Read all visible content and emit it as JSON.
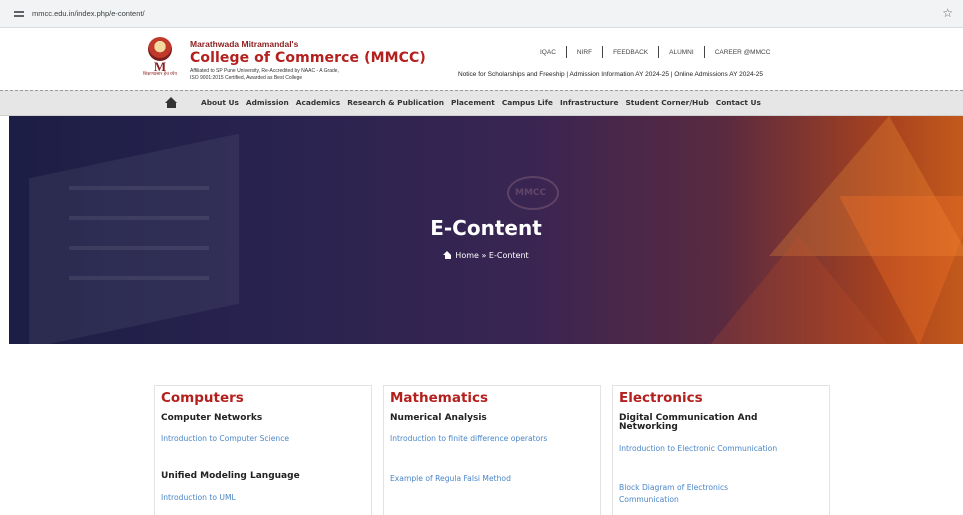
{
  "browser": {
    "url": "mmcc.edu.in/index.php/e-content/"
  },
  "header": {
    "org_small": "Marathwada Mitramandal's",
    "org_big": "College of Commerce (MMCC)",
    "affiliation_1": "Affiliated to SP Pune University, Re-Accredited by NAAC - A Grade,",
    "affiliation_2": "ISO 9001:2015 Certified, Awarded as Best College",
    "logo_tagline": "शिक्षणप्रसार हेच ध्येय",
    "logo_letter": "M",
    "top_links": [
      "IQAC",
      "NIRF",
      "FEEDBACK",
      "ALUMNI",
      "CAREER @MMCC"
    ],
    "notice": "Notice for Scholarships and Freeship | Admission Information AY 2024-25 | Online Admissions AY 2024-25"
  },
  "nav": {
    "items": [
      "About Us",
      "Admission",
      "Academics",
      "Research & Publication",
      "Placement",
      "Campus Life",
      "Infrastructure",
      "Student Corner/Hub",
      "Contact Us"
    ]
  },
  "banner": {
    "title": "E-Content",
    "breadcrumb_home": "Home",
    "breadcrumb_sep": "»",
    "breadcrumb_current": "E-Content",
    "emblem_text": "MMCC"
  },
  "cards": [
    {
      "title": "Computers",
      "sections": [
        {
          "heading": "Computer Networks",
          "links": [
            "Introduction to Computer Science"
          ]
        },
        {
          "heading": "Unified Modeling Language",
          "links": [
            "Introduction to UML"
          ]
        }
      ]
    },
    {
      "title": "Mathematics",
      "sections": [
        {
          "heading": "Numerical Analysis",
          "links": [
            "Introduction to finite difference operators",
            "Example of Regula Falsi Method"
          ]
        }
      ]
    },
    {
      "title": "Electronics",
      "sections": [
        {
          "heading": "Digital Communication And Networking",
          "links": [
            "Introduction to Electronic Communication",
            "Block Diagram of Electronics Communication"
          ]
        }
      ]
    }
  ],
  "colors": {
    "brand_red": "#b3201d",
    "link_blue": "#4a86c8",
    "nav_bg": "#e6e6e6"
  }
}
